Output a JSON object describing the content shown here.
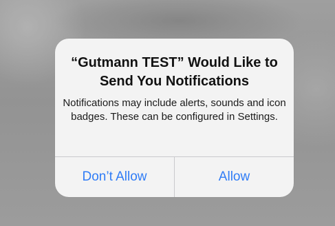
{
  "alert": {
    "title": "“Gutmann TEST” Would Like to Send You Notifications",
    "message": "Notifications may include alerts, sounds and icon badges. These can be configured in Settings.",
    "buttons": {
      "dont_allow": "Don’t Allow",
      "allow": "Allow"
    }
  },
  "colors": {
    "button_text": "#2f7cf6",
    "alert_background": "#f6f6f6",
    "backdrop": "#9b9b9b"
  }
}
